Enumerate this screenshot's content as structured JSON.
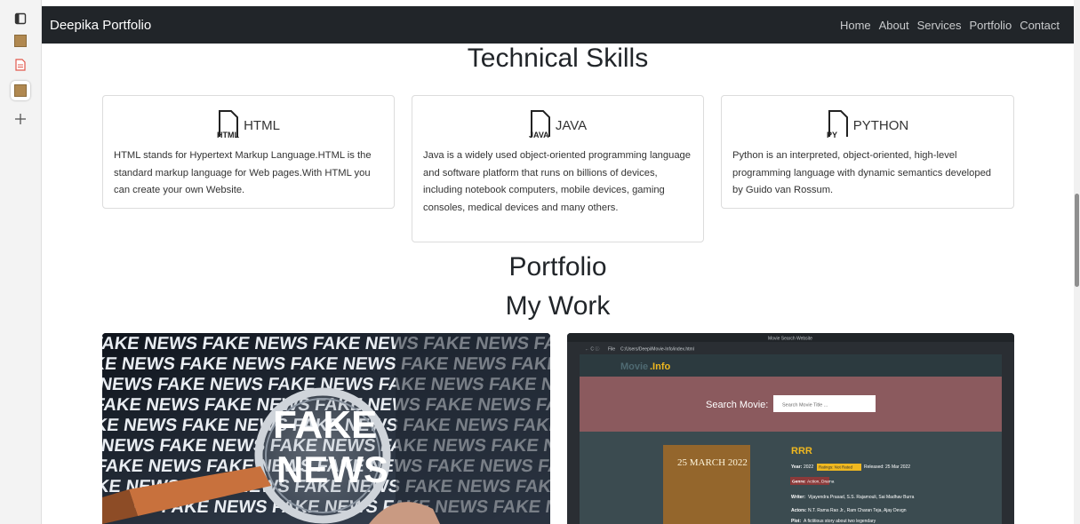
{
  "nav": {
    "brand": "Deepika Portfolio",
    "links": [
      "Home",
      "About",
      "Services",
      "Portfolio",
      "Contact"
    ]
  },
  "skills": {
    "heading": "Technical Skills",
    "cards": [
      {
        "icon_text": "HTML",
        "title": "HTML",
        "text": "HTML stands for Hypertext Markup Language.HTML is the standard markup language for Web pages.With HTML you can create your own Website."
      },
      {
        "icon_text": "JAVA",
        "title": "JAVA",
        "text": "Java is a widely used object-oriented programming language and software platform that runs on billions of devices, including notebook computers, mobile devices, gaming consoles, medical devices and many others."
      },
      {
        "icon_text": "PY",
        "title": "PYTHON",
        "text": "Python is an interpreted, object-oriented, high-level programming language with dynamic semantics developed by Guido van Rossum."
      }
    ]
  },
  "portfolio": {
    "heading": "Portfolio",
    "subheading": "My Work",
    "fake_news": {
      "words": [
        "FAKE",
        "NEWS"
      ]
    },
    "movie_app": {
      "window_title": "Movie Search Website",
      "url": "C:/Users/Deepi/Movie-Info/index.html",
      "file_label": "File",
      "logo_part1": "Movie",
      "logo_part2": ".Info",
      "search_label": "Search Movie:",
      "search_placeholder": "Search Movie Title ...",
      "poster_date": "25 MARCH 2022",
      "title": "RRR",
      "year_label": "Year:",
      "year": "2022",
      "rating_badge": "Ratings: Not Rated",
      "released_label": "Released:",
      "released": "25 Mar 2022",
      "genre_label": "Genre:",
      "genre": "Action, Drama",
      "writer_label": "Writer:",
      "writer": "Vijayendra Prasad, S.S. Rajamouli, Sai Madhav Burra",
      "actors_label": "Actors:",
      "actors": "N.T. Rama Rao Jr., Ram Charan Teja, Ajay Devgn",
      "plot_label": "Plot:",
      "plot": "A fictitious story about two legendary"
    }
  },
  "colors": {
    "navbar": "#212529",
    "movie_header": "#2c3a3f",
    "movie_search_band": "#8b5a5e",
    "movie_body": "#3b4b50",
    "movie_logo_accent": "#f0b81f"
  }
}
